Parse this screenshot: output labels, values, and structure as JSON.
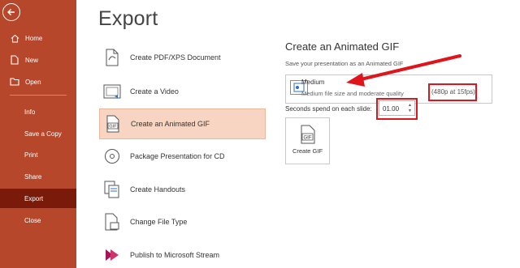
{
  "sidebar": {
    "items": [
      {
        "label": "Home",
        "icon": "home-icon"
      },
      {
        "label": "New",
        "icon": "new-file-icon"
      },
      {
        "label": "Open",
        "icon": "folder-open-icon"
      },
      {
        "label": "Info"
      },
      {
        "label": "Save a Copy"
      },
      {
        "label": "Print"
      },
      {
        "label": "Share"
      },
      {
        "label": "Export",
        "active": true
      },
      {
        "label": "Close"
      }
    ]
  },
  "main": {
    "title": "Export",
    "options": [
      {
        "label": "Create PDF/XPS Document",
        "icon": "pdf-document-icon"
      },
      {
        "label": "Create a Video",
        "icon": "video-icon"
      },
      {
        "label": "Create an Animated GIF",
        "icon": "gif-icon",
        "selected": true
      },
      {
        "label": "Package Presentation for CD",
        "icon": "cd-icon"
      },
      {
        "label": "Create Handouts",
        "icon": "handouts-icon"
      },
      {
        "label": "Change File Type",
        "icon": "change-file-type-icon"
      },
      {
        "label": "Publish to Microsoft Stream",
        "icon": "stream-icon"
      }
    ]
  },
  "panel": {
    "title": "Create an Animated GIF",
    "subtitle": "Save your presentation as an Animated GIF",
    "quality": {
      "name": "Medium",
      "description": "Medium file size and moderate quality",
      "resolution": "(480p at 15fps)"
    },
    "seconds_label": "Seconds spend on each slide:",
    "seconds_value": "01.00",
    "create_button": "Create GIF",
    "gif_icon_text": "GIF"
  },
  "colors": {
    "sidebar": "#b7472a",
    "sidebar_active": "#7a1a0a",
    "selected_option": "#f8d5c2",
    "annotation_red": "#e0141b"
  }
}
